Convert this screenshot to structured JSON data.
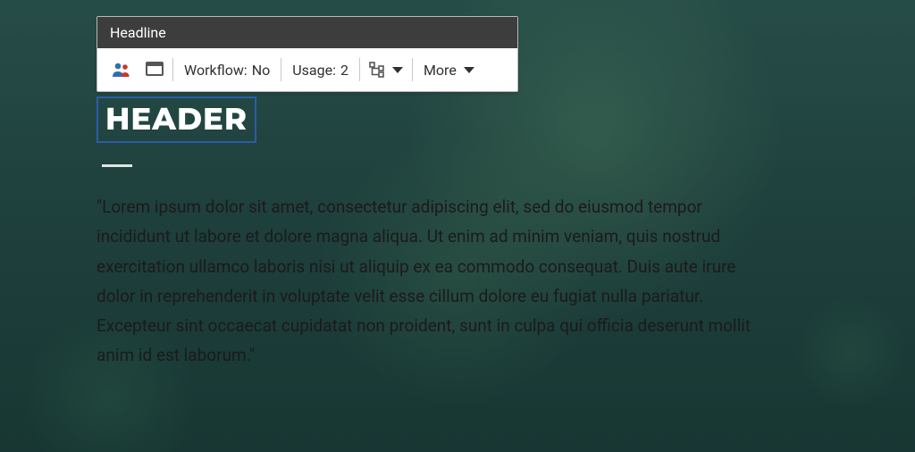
{
  "toolbar": {
    "title": "Headline",
    "workflow_label": "Workflow:",
    "workflow_value": "No",
    "usage_label": "Usage:",
    "usage_value": "2",
    "more_label": "More"
  },
  "content": {
    "header": "HEADER",
    "body": "\"Lorem ipsum dolor sit amet, consectetur adipiscing elit, sed do eiusmod tempor incididunt ut labore et dolore magna aliqua. Ut enim ad minim veniam, quis nostrud exercitation ullamco laboris nisi ut aliquip ex ea commodo consequat. Duis aute irure dolor in reprehenderit in voluptate velit esse cillum dolore eu fugiat nulla pariatur. Excepteur sint occaecat cupidatat non proident, sunt in culpa qui officia deserunt mollit anim id est laborum.\""
  },
  "colors": {
    "selection_border": "#2a5da8",
    "toolbar_header_bg": "#3d3d3d",
    "toolbar_bg": "#ffffff"
  }
}
